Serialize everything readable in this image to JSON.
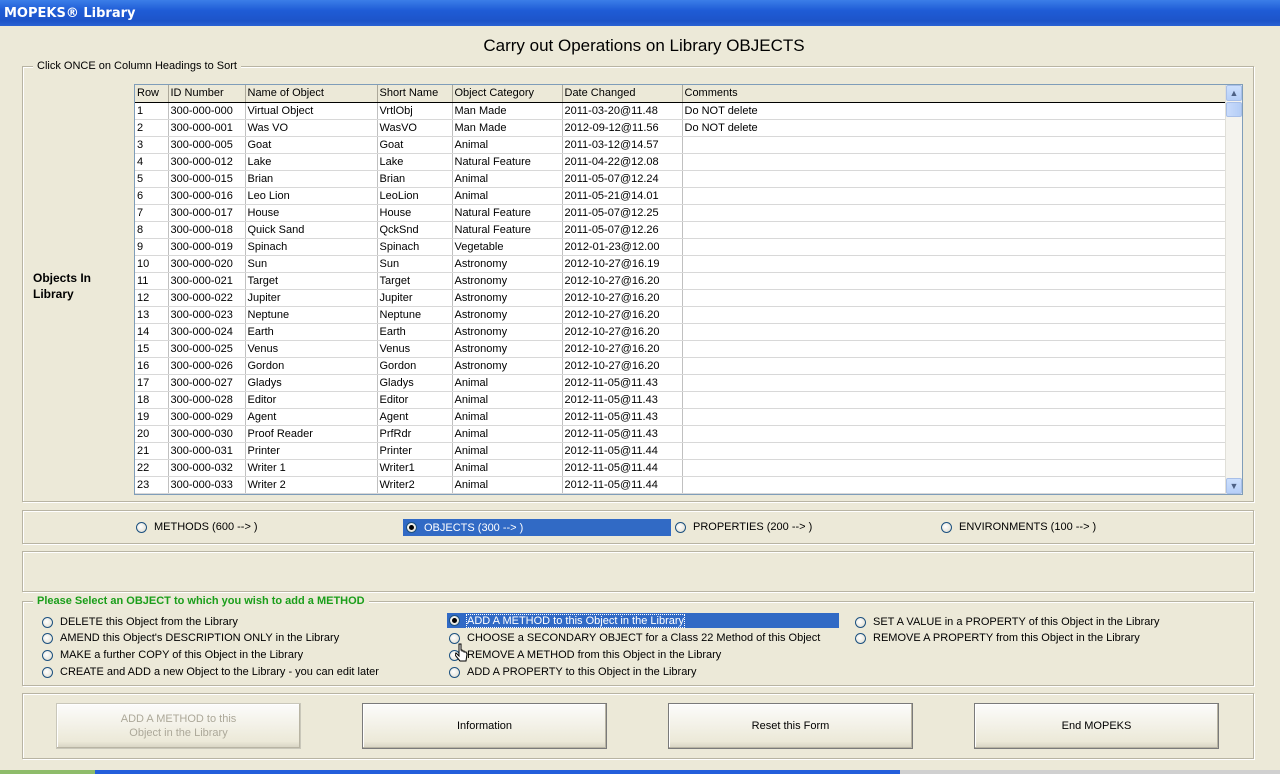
{
  "window": {
    "title": "MOPEKS® Library"
  },
  "page": {
    "title": "Carry out Operations on Library OBJECTS"
  },
  "objects_group": {
    "legend": "Click ONCE on Column Headings to Sort",
    "side_label_line1": "Objects In",
    "side_label_line2": "Library"
  },
  "grid": {
    "columns": [
      "Row",
      "ID Number",
      "Name of Object",
      "Short Name",
      "Object Category",
      "Date Changed",
      "Comments"
    ],
    "rows": [
      [
        "1",
        "300-000-000",
        "Virtual Object",
        "VrtlObj",
        "Man Made",
        "2011-03-20@11.48",
        "Do NOT delete"
      ],
      [
        "2",
        "300-000-001",
        "Was VO",
        "WasVO",
        "Man Made",
        "2012-09-12@11.56",
        "Do NOT delete"
      ],
      [
        "3",
        "300-000-005",
        "Goat",
        "Goat",
        "Animal",
        "2011-03-12@14.57",
        ""
      ],
      [
        "4",
        "300-000-012",
        "Lake",
        "Lake",
        "Natural Feature",
        "2011-04-22@12.08",
        ""
      ],
      [
        "5",
        "300-000-015",
        "Brian",
        "Brian",
        "Animal",
        "2011-05-07@12.24",
        ""
      ],
      [
        "6",
        "300-000-016",
        "Leo Lion",
        "LeoLion",
        "Animal",
        "2011-05-21@14.01",
        ""
      ],
      [
        "7",
        "300-000-017",
        "House",
        "House",
        "Natural Feature",
        "2011-05-07@12.25",
        ""
      ],
      [
        "8",
        "300-000-018",
        "Quick Sand",
        "QckSnd",
        "Natural Feature",
        "2011-05-07@12.26",
        ""
      ],
      [
        "9",
        "300-000-019",
        "Spinach",
        "Spinach",
        "Vegetable",
        "2012-01-23@12.00",
        ""
      ],
      [
        "10",
        "300-000-020",
        "Sun",
        "Sun",
        "Astronomy",
        "2012-10-27@16.19",
        ""
      ],
      [
        "11",
        "300-000-021",
        "Target",
        "Target",
        "Astronomy",
        "2012-10-27@16.20",
        ""
      ],
      [
        "12",
        "300-000-022",
        "Jupiter",
        "Jupiter",
        "Astronomy",
        "2012-10-27@16.20",
        ""
      ],
      [
        "13",
        "300-000-023",
        "Neptune",
        "Neptune",
        "Astronomy",
        "2012-10-27@16.20",
        ""
      ],
      [
        "14",
        "300-000-024",
        "Earth",
        "Earth",
        "Astronomy",
        "2012-10-27@16.20",
        ""
      ],
      [
        "15",
        "300-000-025",
        "Venus",
        "Venus",
        "Astronomy",
        "2012-10-27@16.20",
        ""
      ],
      [
        "16",
        "300-000-026",
        "Gordon",
        "Gordon",
        "Astronomy",
        "2012-10-27@16.20",
        ""
      ],
      [
        "17",
        "300-000-027",
        "Gladys",
        "Gladys",
        "Animal",
        "2012-11-05@11.43",
        ""
      ],
      [
        "18",
        "300-000-028",
        "Editor",
        "Editor",
        "Animal",
        "2012-11-05@11.43",
        ""
      ],
      [
        "19",
        "300-000-029",
        "Agent",
        "Agent",
        "Animal",
        "2012-11-05@11.43",
        ""
      ],
      [
        "20",
        "300-000-030",
        "Proof Reader",
        "PrfRdr",
        "Animal",
        "2012-11-05@11.43",
        ""
      ],
      [
        "21",
        "300-000-031",
        "Printer",
        "Printer",
        "Animal",
        "2012-11-05@11.44",
        ""
      ],
      [
        "22",
        "300-000-032",
        "Writer 1",
        "Writer1",
        "Animal",
        "2012-11-05@11.44",
        ""
      ],
      [
        "23",
        "300-000-033",
        "Writer 2",
        "Writer2",
        "Animal",
        "2012-11-05@11.44",
        ""
      ]
    ]
  },
  "type_radios": {
    "methods": "METHODS (600 --> )",
    "objects": "OBJECTS (300 --> )",
    "properties": "PROPERTIES (200 --> )",
    "environments": "ENVIRONMENTS (100 --> )",
    "selected": "objects"
  },
  "operations": {
    "legend": "Please Select an OBJECT to which you wish to add a METHOD",
    "col1": [
      "DELETE this Object from the Library",
      "AMEND this Object's DESCRIPTION ONLY in the Library",
      "MAKE a further COPY of this Object in the Library",
      "CREATE and ADD a new Object to the Library - you can edit later"
    ],
    "col2": [
      "ADD A METHOD to this Object in the Library",
      "CHOOSE a SECONDARY OBJECT for a Class 22 Method of this Object",
      "REMOVE A METHOD from this Object in the Library",
      "ADD A PROPERTY to this Object in the Library"
    ],
    "col3": [
      "SET A VALUE in a PROPERTY of this Object in the Library",
      "REMOVE A PROPERTY from this Object in the Library"
    ],
    "selected": "ADD A METHOD to this Object in the Library"
  },
  "buttons": {
    "primary_line1": "ADD A METHOD to this",
    "primary_line2": "Object in the Library",
    "information": "Information",
    "reset": "Reset this Form",
    "end": "End MOPEKS"
  },
  "colors": {
    "selection": "#316ac5",
    "legend_green": "#1a9e1a",
    "titlebar": "#1f5cd6"
  }
}
